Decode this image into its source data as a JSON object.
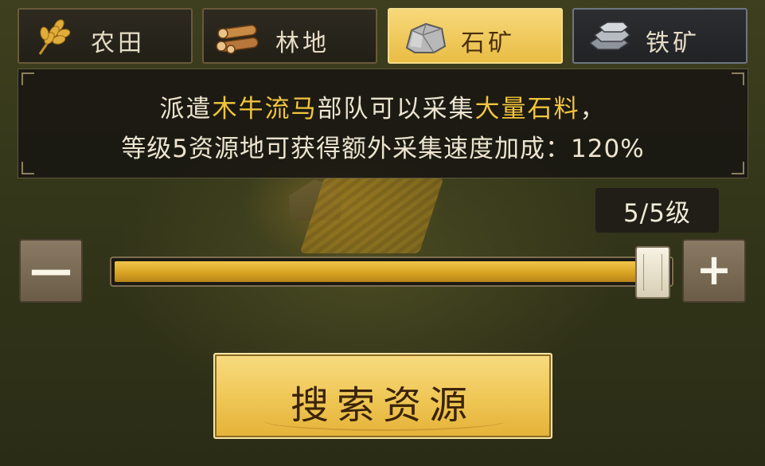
{
  "tabs": [
    {
      "label": "农田",
      "icon": "wheat-icon",
      "active": false
    },
    {
      "label": "林地",
      "icon": "logs-icon",
      "active": false
    },
    {
      "label": "石矿",
      "icon": "stone-icon",
      "active": true
    },
    {
      "label": "铁矿",
      "icon": "iron-ingot-icon",
      "active": false
    }
  ],
  "info": {
    "line1": {
      "pre": "派遣",
      "unit": "木牛流马",
      "mid": "部队可以采集",
      "resource": "大量石料",
      "post": "，"
    },
    "line2": "等级5资源地可获得额外采集速度加成：120%"
  },
  "level": {
    "label": "5/5级",
    "current": 5,
    "max": 5
  },
  "slider": {
    "minus": "—",
    "plus": "+",
    "fraction": 1.0
  },
  "search_button": "搜索资源",
  "colors": {
    "highlight": "#f2c53d",
    "active_tab": "#efc654",
    "slider_fill": "#d9a322"
  }
}
